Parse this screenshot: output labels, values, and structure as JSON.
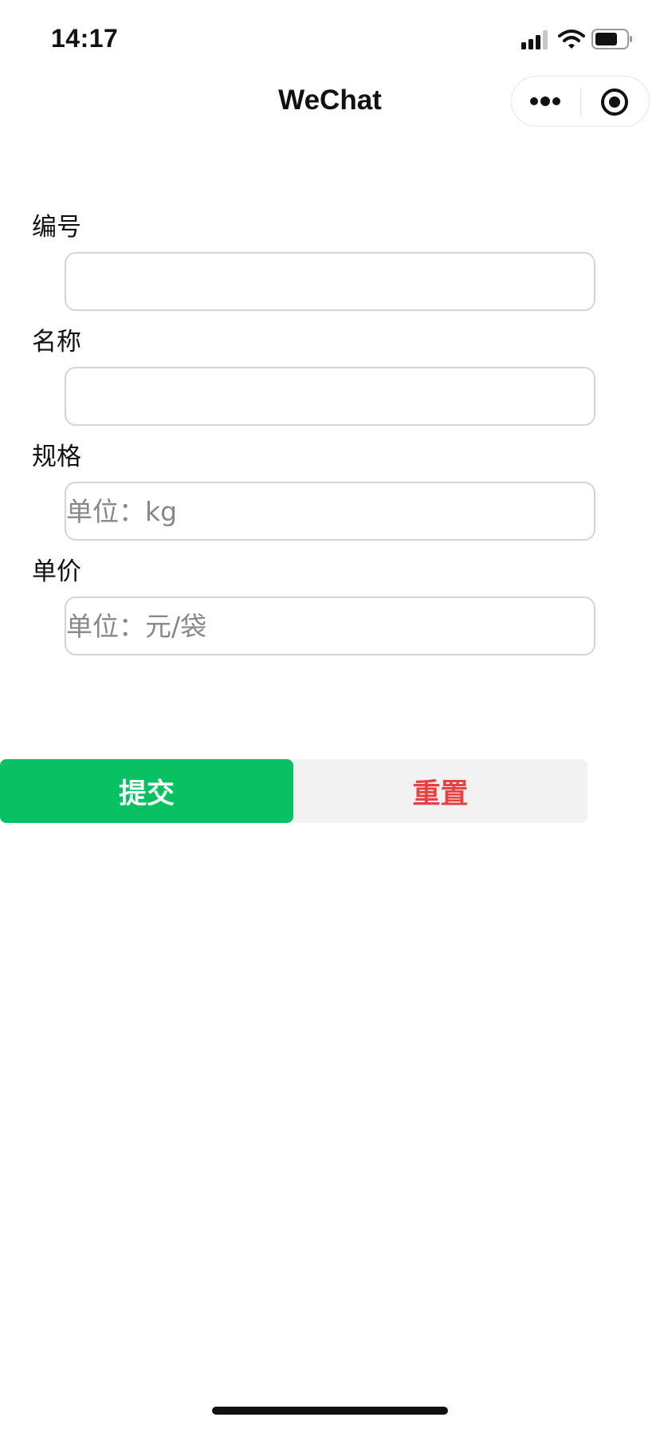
{
  "status_bar": {
    "time": "14:17",
    "icons": [
      "signal-icon",
      "wifi-icon",
      "battery-icon"
    ]
  },
  "nav": {
    "title": "WeChat",
    "capsule_icons": [
      "more-icon",
      "close-miniprogram-icon"
    ]
  },
  "form": {
    "fields": [
      {
        "label": "编号",
        "value": "",
        "placeholder": ""
      },
      {
        "label": "名称",
        "value": "",
        "placeholder": ""
      },
      {
        "label": "规格",
        "value": "",
        "placeholder": "单位：kg"
      },
      {
        "label": "单价",
        "value": "",
        "placeholder": "单位：元/袋"
      }
    ]
  },
  "actions": {
    "submit_label": "提交",
    "reset_label": "重置"
  },
  "colors": {
    "primary": "#07c160",
    "danger": "#e64340",
    "secondary_bg": "#f2f2f2"
  }
}
